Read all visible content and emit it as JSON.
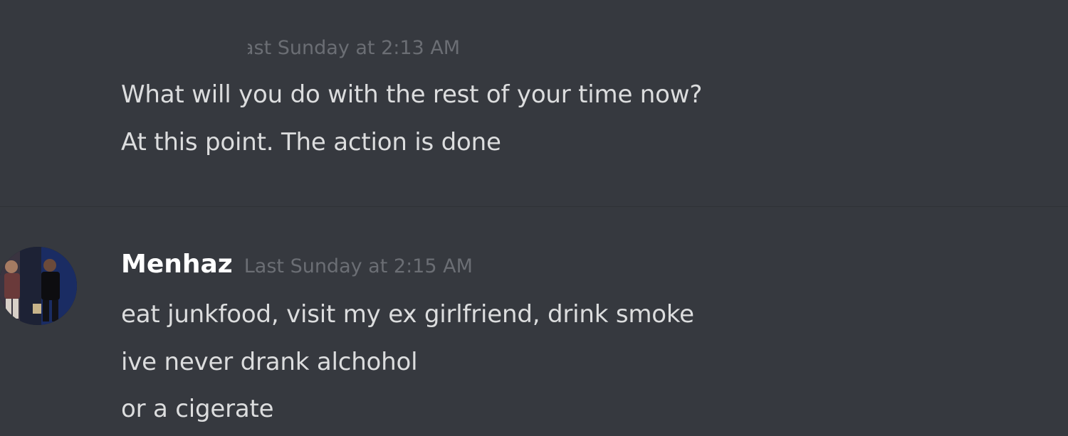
{
  "messages": [
    {
      "timestamp": "ast Sunday at 2:13 AM",
      "lines": [
        "What will you do with the rest of your time now?",
        "At this point. The action is done"
      ]
    },
    {
      "author": "Menhaz",
      "timestamp": "Last Sunday at 2:15 AM",
      "lines": [
        "eat junkfood, visit my ex girlfriend, drink smoke",
        "ive never drank alchohol",
        "or a cigerate"
      ]
    }
  ],
  "colors": {
    "background": "#36393f",
    "message_text": "#dcddde",
    "username": "#ffffff",
    "timestamp": "#6b6e74"
  }
}
